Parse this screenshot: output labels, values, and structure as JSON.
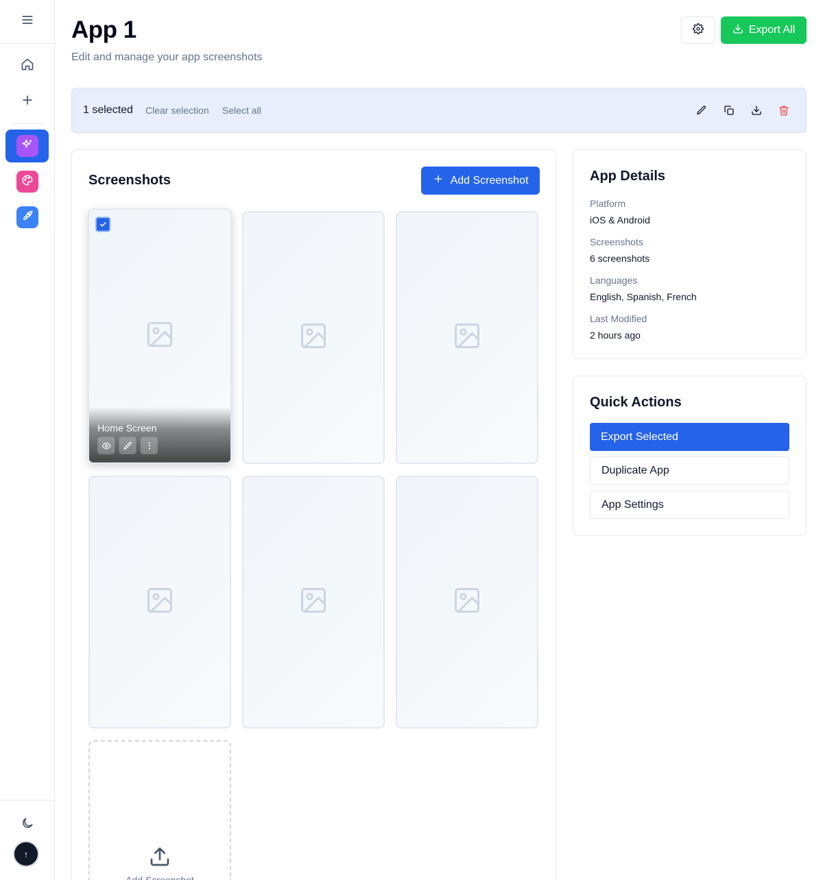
{
  "page": {
    "title": "App 1",
    "subtitle": "Edit and manage your app screenshots",
    "export_all_label": "Export All"
  },
  "sidebar": {
    "menu_icon": "menu-icon",
    "items": [
      {
        "icon": "home-icon"
      },
      {
        "icon": "plus-icon"
      }
    ],
    "apps": [
      {
        "icon": "sparkles-icon",
        "color": "#a855f7",
        "active": true
      },
      {
        "icon": "palette-icon",
        "color": "#ec4899"
      },
      {
        "icon": "rocket-icon",
        "color": "#3b82f6"
      }
    ],
    "theme_icon": "moon-icon",
    "avatar_text": "↑"
  },
  "selection": {
    "count_label": "1 selected",
    "clear_label": "Clear selection",
    "select_all_label": "Select all"
  },
  "screenshots": {
    "title": "Screenshots",
    "add_label": "Add Screenshot",
    "items": [
      {
        "name": "Home Screen",
        "selected": true
      },
      {
        "name": "",
        "selected": false
      },
      {
        "name": "",
        "selected": false
      },
      {
        "name": "",
        "selected": false
      },
      {
        "name": "",
        "selected": false
      },
      {
        "name": "",
        "selected": false
      }
    ],
    "upload_label": "Add Screenshot"
  },
  "details": {
    "title": "App Details",
    "fields": [
      {
        "label": "Platform",
        "value": "iOS & Android"
      },
      {
        "label": "Screenshots",
        "value": "6 screenshots"
      },
      {
        "label": "Languages",
        "value": "English, Spanish, French"
      },
      {
        "label": "Last Modified",
        "value": "2 hours ago"
      }
    ]
  },
  "quick_actions": {
    "title": "Quick Actions",
    "buttons": [
      "Export Selected",
      "Duplicate App",
      "App Settings"
    ]
  },
  "colors": {
    "primary": "#2563eb",
    "success": "#16c75a",
    "danger": "#ef4444"
  }
}
